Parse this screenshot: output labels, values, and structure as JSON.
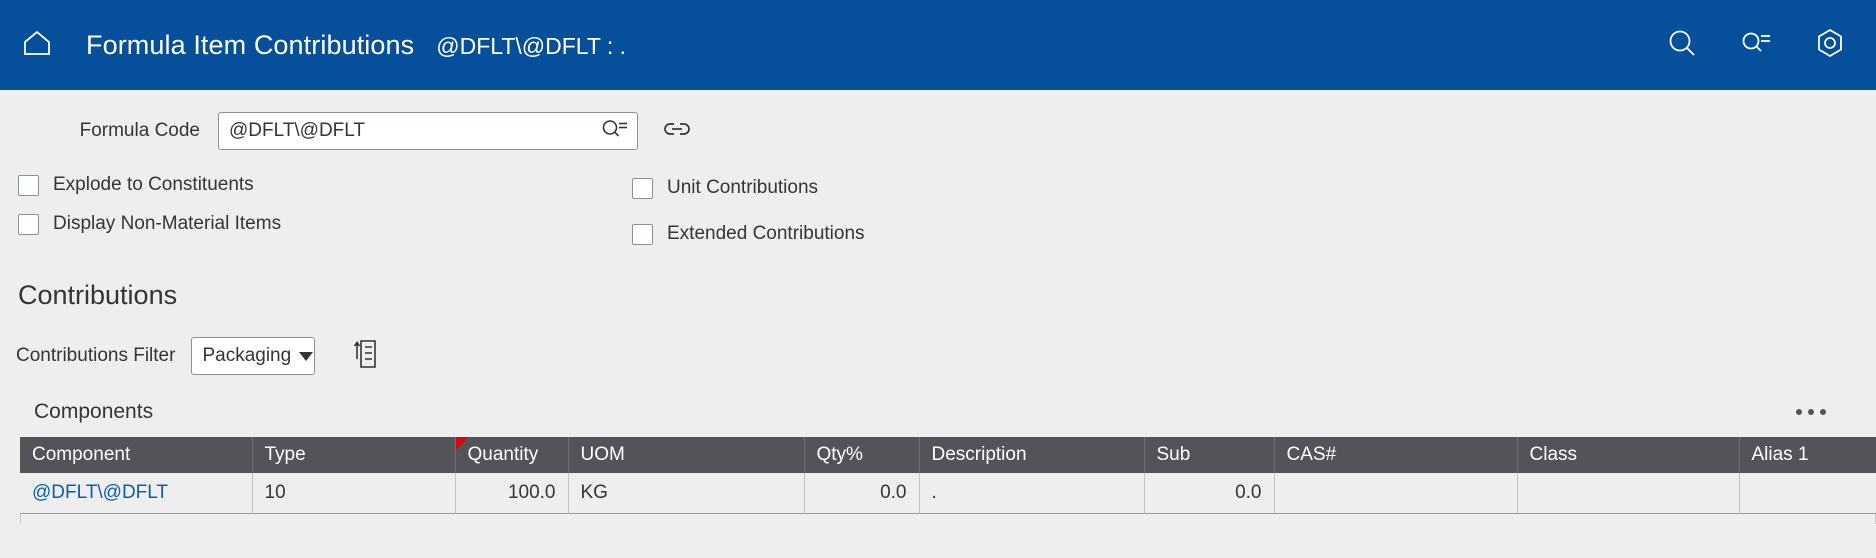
{
  "header": {
    "home_icon": "home-pentagon-icon",
    "title": "Formula Item Contributions",
    "subtitle": "@DFLT\\@DFLT : .",
    "brand_color": "#064f9b",
    "actions": [
      {
        "name": "search-icon",
        "label": "Search"
      },
      {
        "name": "query-search-icon",
        "label": "Value Help Search"
      },
      {
        "name": "settings-hexagon-icon",
        "label": "Settings"
      }
    ]
  },
  "form": {
    "formula_code": {
      "label": "Formula Code",
      "value": "@DFLT\\@DFLT",
      "placeholder": "",
      "value_help_icon": "query-search-icon"
    },
    "link_icon": "chain-link-icon",
    "checkboxes": [
      {
        "label": "Explode to Constituents",
        "checked": false
      },
      {
        "label": "Display Non-Material Items",
        "checked": false
      },
      {
        "label": "Unit Contributions",
        "checked": false
      },
      {
        "label": "Extended Contributions",
        "checked": false
      }
    ]
  },
  "contributions": {
    "title": "Contributions",
    "filter_label": "Contributions Filter",
    "filter_value": "Packaging",
    "filter_options": [
      "Packaging"
    ],
    "sort_icon": "sort-ascending-document-icon"
  },
  "components": {
    "caption": "Components",
    "overflow_menu": "overflow-dots-icon",
    "columns": [
      {
        "label": "Component",
        "align": "left",
        "marked": false
      },
      {
        "label": "Type",
        "align": "left",
        "marked": false
      },
      {
        "label": "Quantity",
        "align": "left",
        "marked": true
      },
      {
        "label": "UOM",
        "align": "left",
        "marked": false
      },
      {
        "label": "Qty%",
        "align": "left",
        "marked": false
      },
      {
        "label": "Description",
        "align": "left",
        "marked": false
      },
      {
        "label": "Sub",
        "align": "left",
        "marked": false
      },
      {
        "label": "CAS#",
        "align": "left",
        "marked": false
      },
      {
        "label": "Class",
        "align": "left",
        "marked": false
      },
      {
        "label": "Alias 1",
        "align": "left",
        "marked": false
      }
    ],
    "rows": [
      {
        "component": "@DFLT\\@DFLT",
        "type": "10",
        "quantity": "100.0",
        "uom": "KG",
        "qty_pct": "0.0",
        "description": ".",
        "sub": "0.0",
        "cas": "",
        "class": "",
        "alias1": ""
      }
    ]
  }
}
